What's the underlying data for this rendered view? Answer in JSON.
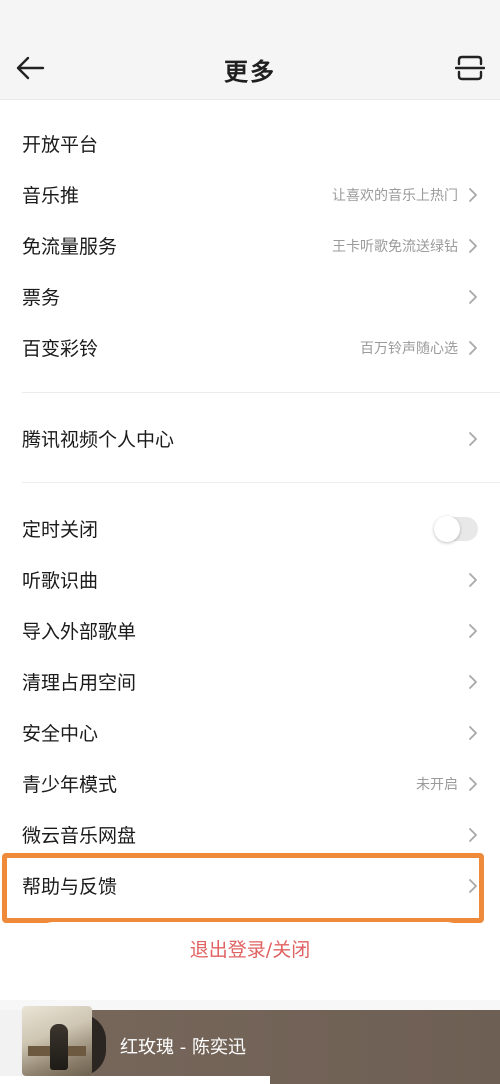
{
  "header": {
    "title": "更多",
    "back_icon": "arrow-left-icon",
    "scan_icon": "scan-icon"
  },
  "sections": [
    {
      "items": [
        {
          "label": "开放平台",
          "hint": ""
        },
        {
          "label": "音乐推",
          "hint": "让喜欢的音乐上热门"
        },
        {
          "label": "免流量服务",
          "hint": "王卡听歌免流送绿钻"
        },
        {
          "label": "票务",
          "hint": ""
        },
        {
          "label": "百变彩铃",
          "hint": "百万铃声随心选"
        }
      ]
    },
    {
      "items": [
        {
          "label": "腾讯视频个人中心",
          "hint": ""
        }
      ]
    },
    {
      "items": [
        {
          "label": "定时关闭",
          "hint": "",
          "toggle": false
        },
        {
          "label": "听歌识曲",
          "hint": ""
        },
        {
          "label": "导入外部歌单",
          "hint": ""
        },
        {
          "label": "清理占用空间",
          "hint": ""
        },
        {
          "label": "安全中心",
          "hint": ""
        },
        {
          "label": "青少年模式",
          "hint": "未开启"
        },
        {
          "label": "微云音乐网盘",
          "hint": ""
        },
        {
          "label": "帮助与反馈",
          "hint": ""
        }
      ]
    }
  ],
  "logout": {
    "label": "退出登录/关闭"
  },
  "player": {
    "song": "红玫瑰 - 陈奕迅"
  },
  "colors": {
    "highlight": "#f08a3b",
    "logout_text": "#e06262",
    "hint_text": "#9b9b9b"
  }
}
